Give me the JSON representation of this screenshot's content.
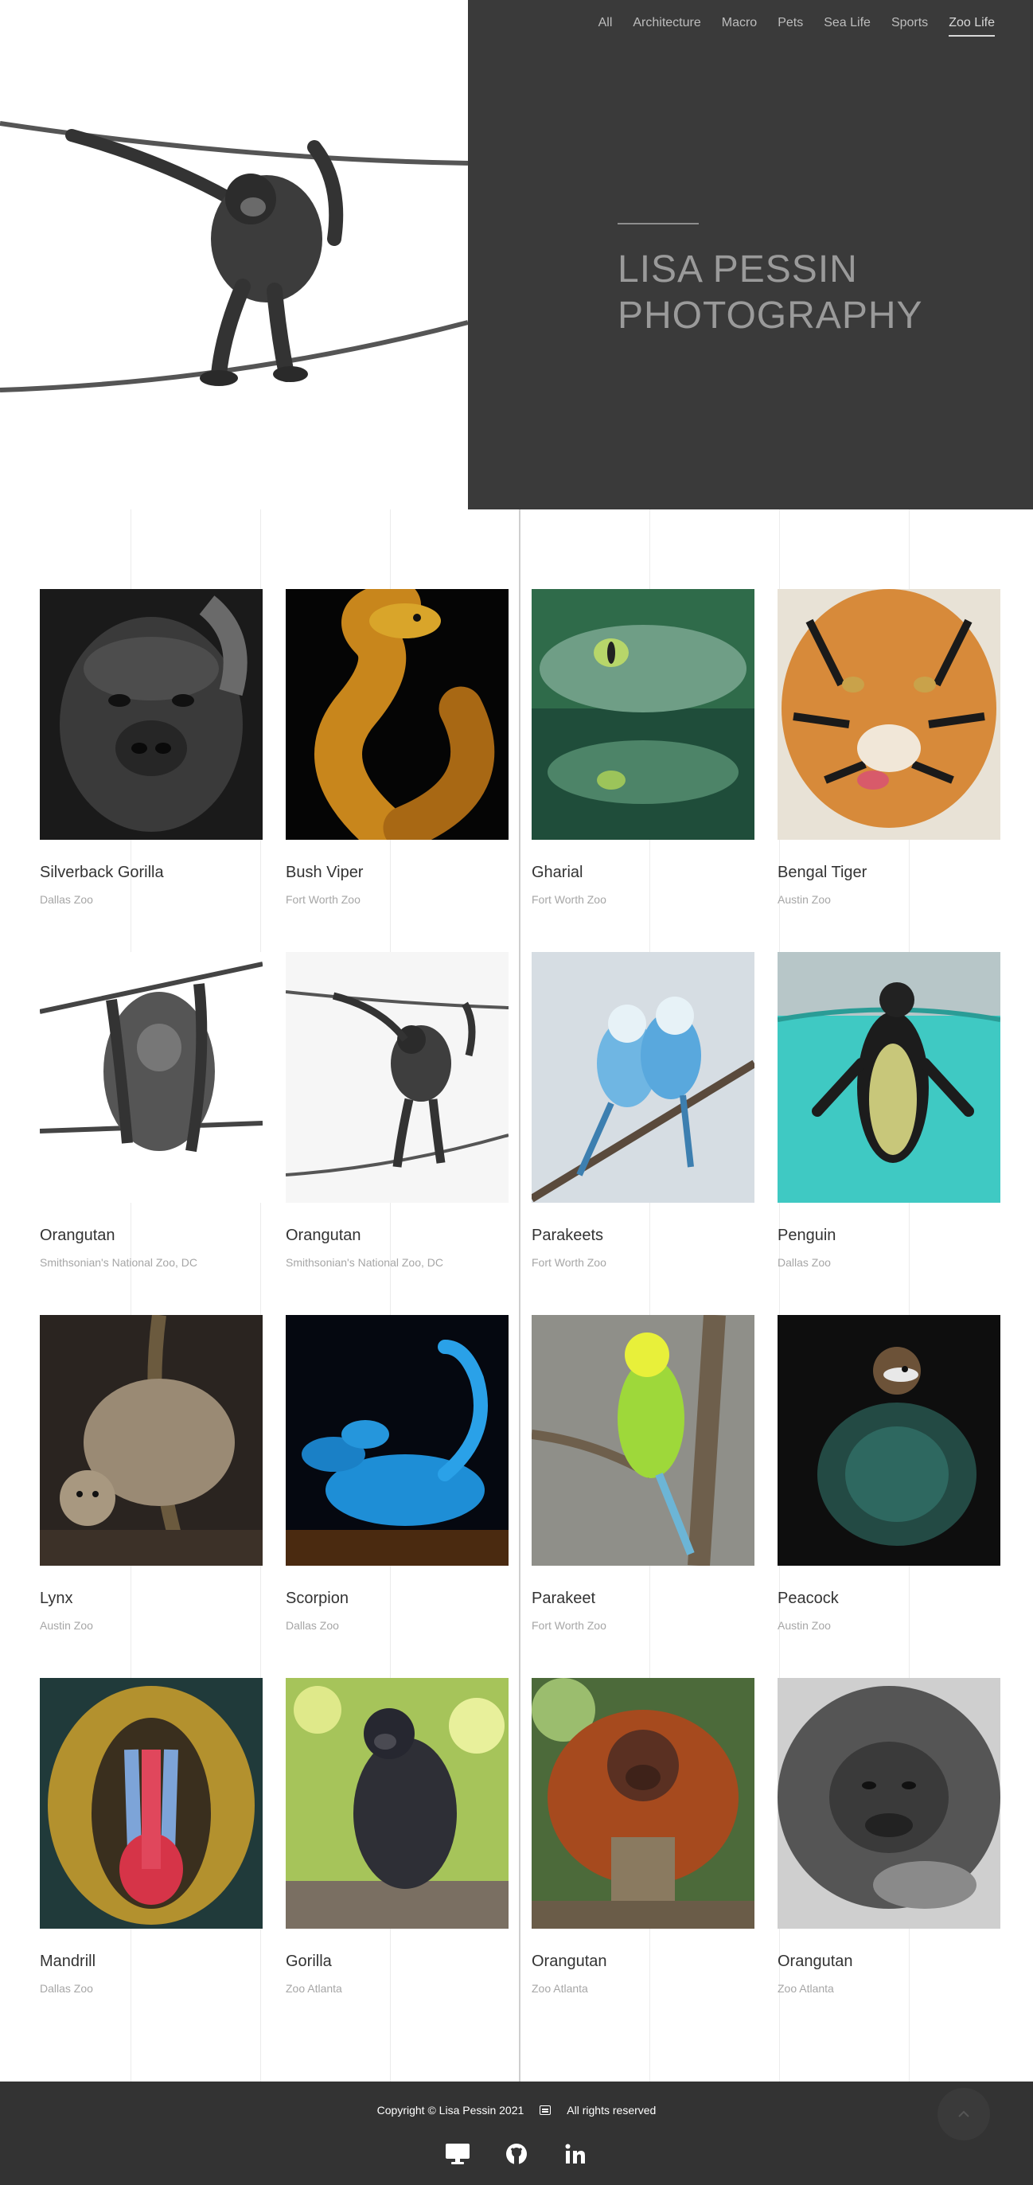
{
  "nav": {
    "items": [
      {
        "label": "All"
      },
      {
        "label": "Architecture"
      },
      {
        "label": "Macro"
      },
      {
        "label": "Pets"
      },
      {
        "label": "Sea Life"
      },
      {
        "label": "Sports"
      },
      {
        "label": "Zoo Life",
        "active": true
      }
    ]
  },
  "hero": {
    "title": "LISA PESSIN PHOTOGRAPHY",
    "photo_icon": "orangutan-on-rope-photo"
  },
  "gallery": [
    {
      "title": "Silverback Gorilla",
      "location": "Dallas Zoo",
      "photo": "gorilla-bw"
    },
    {
      "title": "Bush Viper",
      "location": "Fort Worth Zoo",
      "photo": "snake"
    },
    {
      "title": "Gharial",
      "location": "Fort Worth Zoo",
      "photo": "gharial"
    },
    {
      "title": "Bengal Tiger",
      "location": "Austin Zoo",
      "photo": "tiger"
    },
    {
      "title": "Orangutan",
      "location": "Smithsonian's National Zoo, DC",
      "photo": "orangutan-hanging-bw"
    },
    {
      "title": "Orangutan",
      "location": "Smithsonian's National Zoo, DC",
      "photo": "orangutan-rope-bw"
    },
    {
      "title": "Parakeets",
      "location": "Fort Worth Zoo",
      "photo": "parakeets"
    },
    {
      "title": "Penguin",
      "location": "Dallas Zoo",
      "photo": "penguin"
    },
    {
      "title": "Lynx",
      "location": "Austin Zoo",
      "photo": "lynx"
    },
    {
      "title": "Scorpion",
      "location": "Dallas Zoo",
      "photo": "scorpion"
    },
    {
      "title": "Parakeet",
      "location": "Fort Worth Zoo",
      "photo": "parakeet"
    },
    {
      "title": "Peacock",
      "location": "Austin Zoo",
      "photo": "peacock"
    },
    {
      "title": "Mandrill",
      "location": "Dallas Zoo",
      "photo": "mandrill"
    },
    {
      "title": "Gorilla",
      "location": "Zoo Atlanta",
      "photo": "gorilla-color"
    },
    {
      "title": "Orangutan",
      "location": "Zoo Atlanta",
      "photo": "orangutan-color"
    },
    {
      "title": "Orangutan",
      "location": "Zoo Atlanta",
      "photo": "orangutan-closeup-bw"
    }
  ],
  "footer": {
    "copyright": "Copyright © Lisa Pessin 2021",
    "rights": "All rights reserved",
    "social": [
      {
        "icon": "desktop-icon"
      },
      {
        "icon": "github-icon"
      },
      {
        "icon": "linkedin-icon"
      }
    ],
    "back_to_top_icon": "chevron-up-icon"
  },
  "colors": {
    "hero_panel": "#3a3a3a",
    "footer": "#333333",
    "title_text": "#9a9a9a",
    "nav_text": "#bdbdbd"
  }
}
